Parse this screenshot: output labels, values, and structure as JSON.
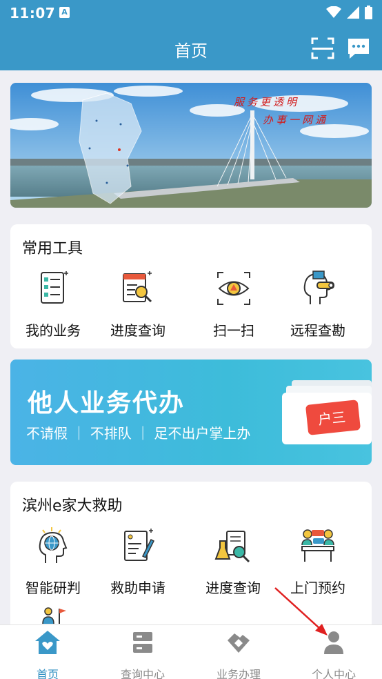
{
  "status_bar": {
    "time": "11:07",
    "notif_icon": "A"
  },
  "header": {
    "title": "首页",
    "scan_icon": "scan-icon",
    "message_icon": "message-icon"
  },
  "banner": {
    "slogan_line1": "服务更透明",
    "slogan_line2": "办事一网通"
  },
  "tools_card": {
    "title": "常用工具",
    "items": [
      {
        "label": "我的业务",
        "icon": "checklist-icon"
      },
      {
        "label": "进度查询",
        "icon": "document-search-icon"
      },
      {
        "label": "扫一扫",
        "icon": "eye-scan-icon"
      },
      {
        "label": "远程查勘",
        "icon": "remote-survey-icon"
      }
    ]
  },
  "promo": {
    "title": "他人业务代办",
    "subtitle": "不请假 ｜ 不排队 ｜ 足不出户掌上办",
    "card_text": "户三"
  },
  "rescue_card": {
    "title": "滨州e家大救助",
    "items": [
      {
        "label": "智能研判",
        "icon": "globe-head-icon"
      },
      {
        "label": "救助申请",
        "icon": "form-pen-icon"
      },
      {
        "label": "进度查询",
        "icon": "lab-flask-icon"
      },
      {
        "label": "上门预约",
        "icon": "meeting-icon"
      }
    ]
  },
  "tabbar": {
    "items": [
      {
        "label": "首页",
        "icon": "home-icon",
        "active": true
      },
      {
        "label": "查询中心",
        "icon": "server-icon",
        "active": false
      },
      {
        "label": "业务办理",
        "icon": "handshake-icon",
        "active": false
      },
      {
        "label": "个人中心",
        "icon": "person-icon",
        "active": false
      }
    ]
  },
  "colors": {
    "primary": "#3a98c8",
    "tab_active": "#2f8fc2",
    "tab_inactive": "#8a8a8a",
    "arrow": "#e02020"
  }
}
